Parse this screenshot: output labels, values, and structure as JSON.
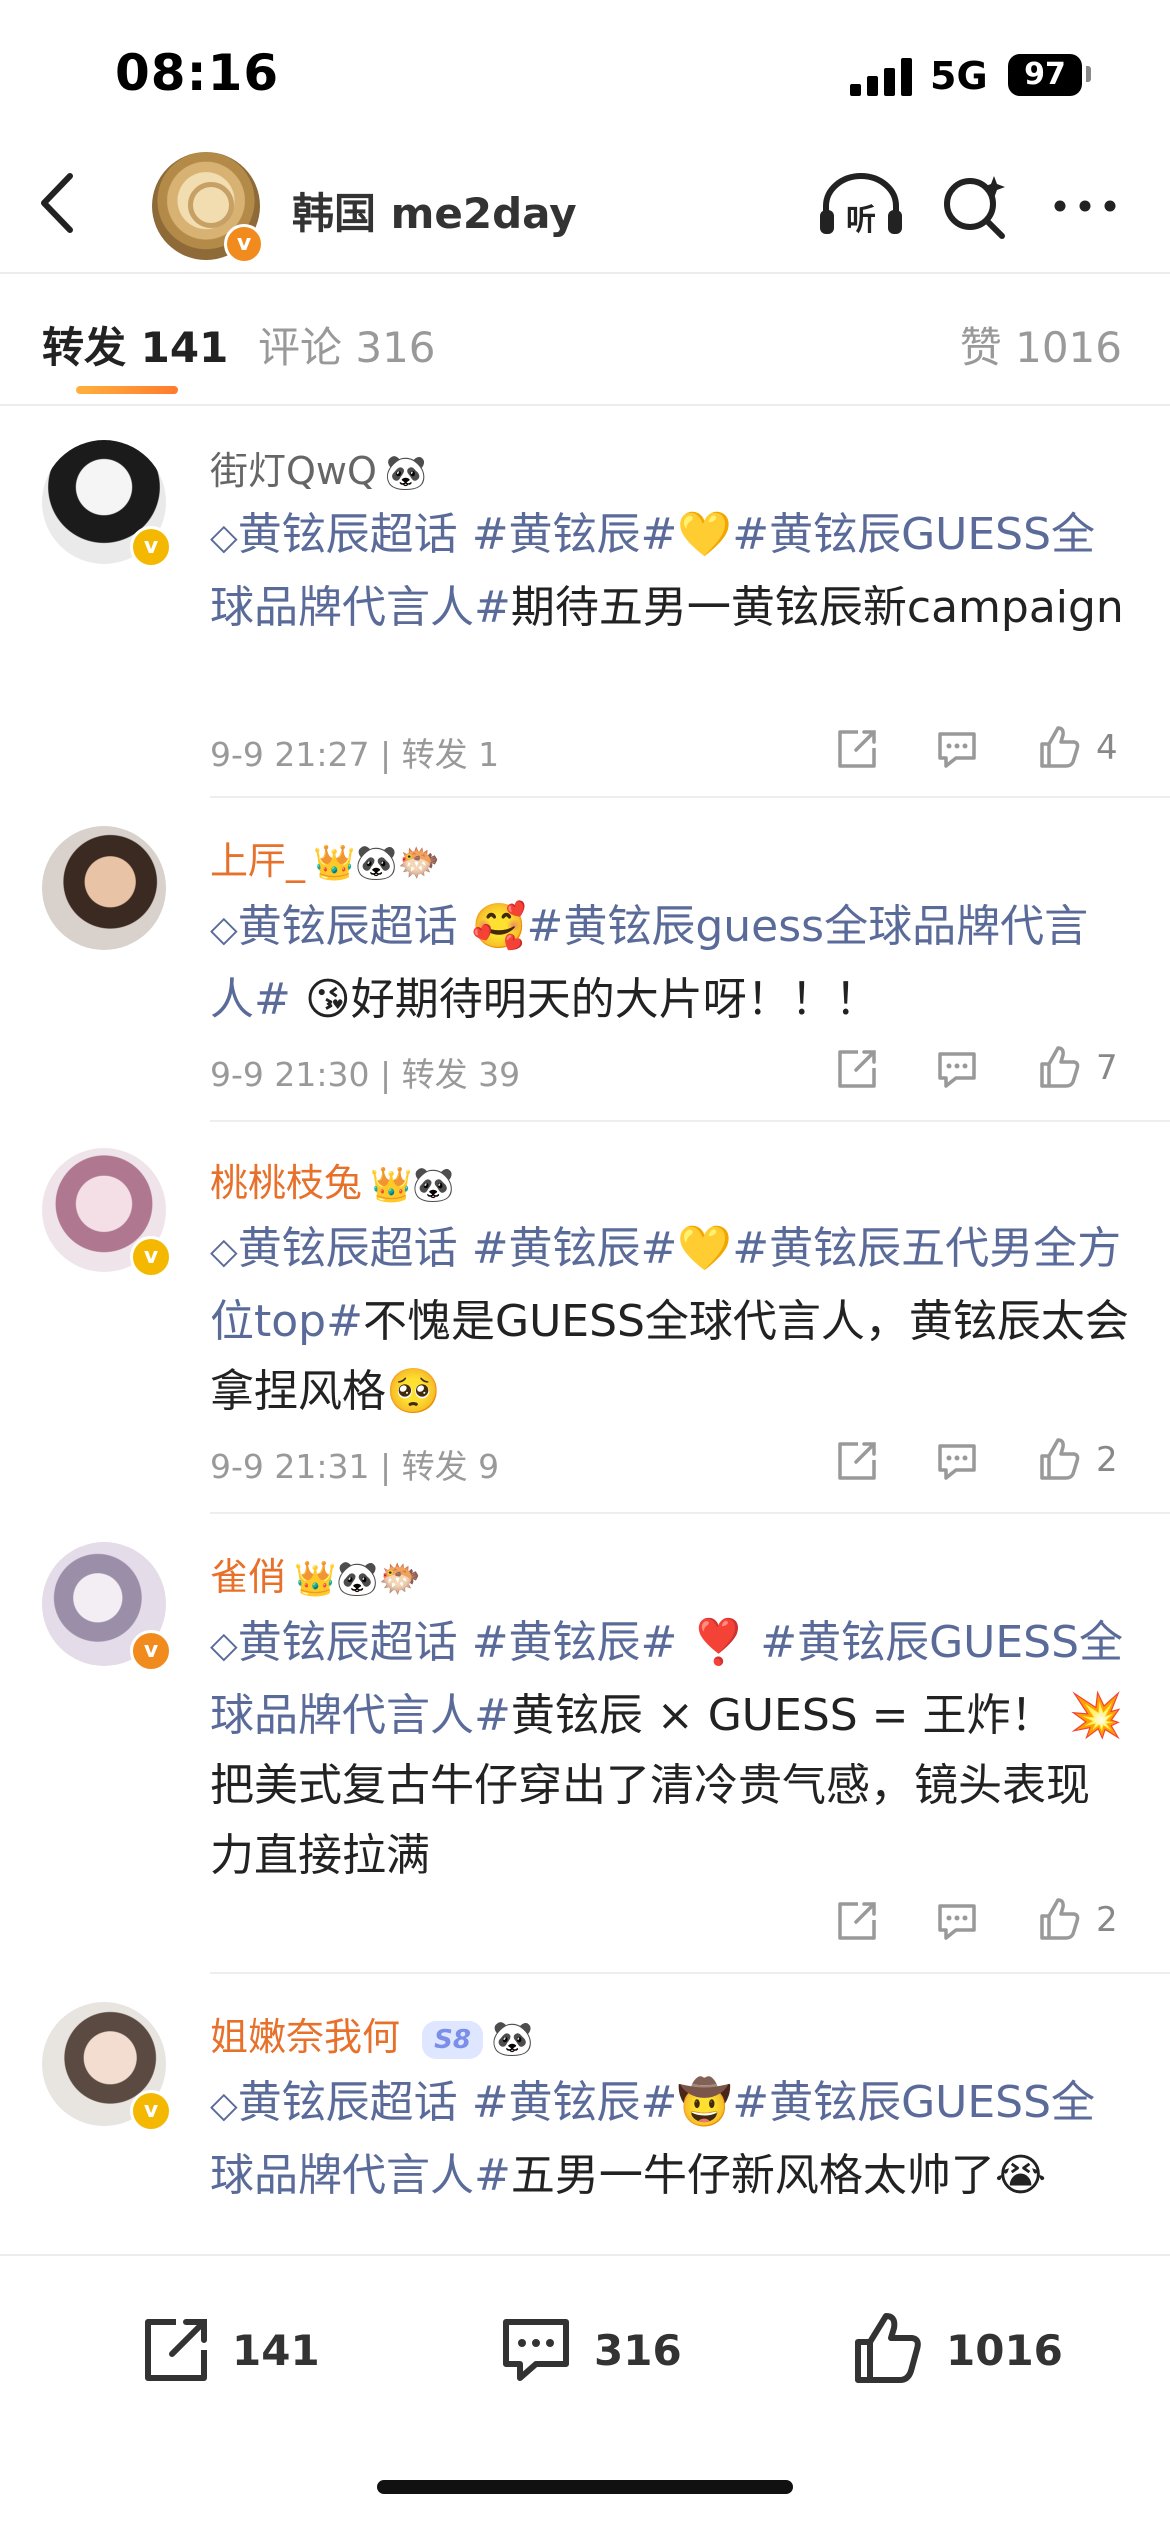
{
  "status": {
    "time": "08:16",
    "network": "5G",
    "battery": "97"
  },
  "header": {
    "title": "韩国 me2day",
    "icons": [
      "back-icon",
      "listen-icon",
      "search-sparkle-icon",
      "more-icon"
    ],
    "listen_label": "听"
  },
  "tabs": {
    "repost": "转发 141",
    "comment": "评论 316",
    "like": "赞 1016"
  },
  "posts": [
    {
      "username": "街灯QwQ",
      "badge_emoji": "🐼",
      "body": {
        "t1": "黄铉辰超话",
        "t2": "#黄铉辰#",
        "e1": "💛",
        "t3": "#黄铉辰GUESS全球品牌代言人#",
        "text": "期待五男一黄铉辰新campaign"
      },
      "meta": "9-9 21:27 | 转发 1",
      "likes": "4"
    },
    {
      "username": "上厈_",
      "badge_emoji": "👑🐼🐡",
      "body": {
        "t1": "黄铉辰超话",
        "e1": "🥰",
        "t2": "#黄铉辰guess全球品牌代言人#",
        "e2": "😘",
        "text": "好期待明天的大片呀！！！"
      },
      "meta": "9-9 21:30 | 转发 39",
      "likes": "7"
    },
    {
      "username": "桃桃枝兔",
      "badge_emoji": "👑🐼",
      "body": {
        "t1": "黄铉辰超话",
        "t2": "#黄铉辰#",
        "e1": "💛",
        "t3": "#黄铉辰五代男全方位top#",
        "text": "不愧是GUESS全球代言人，黄铉辰太会拿捏风格",
        "e2": "🥺"
      },
      "meta": "9-9 21:31 | 转发 9",
      "likes": "2"
    },
    {
      "username": "雀俏",
      "badge_emoji": "👑🐼🐡",
      "body": {
        "t1": "黄铉辰超话",
        "t2": "#黄铉辰#",
        "e1": "❣️",
        "t3": "#黄铉辰GUESS全球品牌代言人#",
        "text1": "黄铉辰 × GUESS = 王炸！",
        "e2": "💥",
        "text2": "把美式复古牛仔穿出了清冷贵气感，镜头表现力直接拉满"
      },
      "meta": "",
      "likes": "2"
    },
    {
      "username": "姐嫩奈我何",
      "badge_label": "S8",
      "badge_emoji": "🐼",
      "body": {
        "t1": "黄铉辰超话",
        "t2": "#黄铉辰#",
        "e1": "🤠",
        "t3": "#黄铉辰GUESS全球品牌代言人#",
        "text": "五男一牛仔新风格太帅了",
        "e2": "😭"
      }
    }
  ],
  "bottom_bar": {
    "repost": "141",
    "comment": "316",
    "like": "1016"
  },
  "colors": {
    "accent": "#ff8a2b",
    "topic": "#5a6b9a",
    "username_orange": "#e7702a",
    "muted": "#999999"
  }
}
